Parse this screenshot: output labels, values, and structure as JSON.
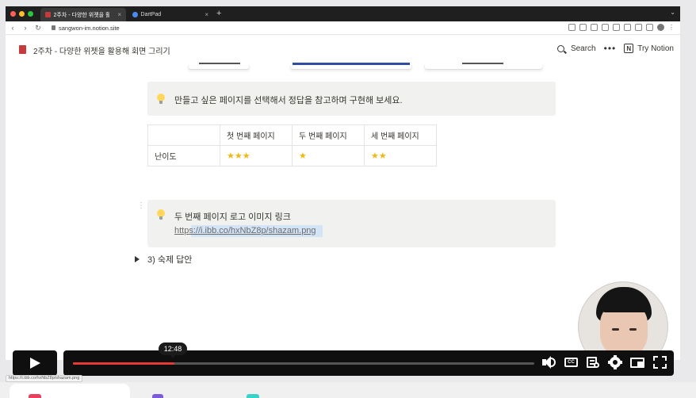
{
  "browser": {
    "tabs": [
      {
        "label": "2주차 - 다양한 위젯을 활용해 회",
        "favicon_color": "#c53a3a",
        "active": true
      },
      {
        "label": "DartPad",
        "favicon_color": "#4a8cf7",
        "active": false
      }
    ],
    "tab_close": "×",
    "new_tab": "+",
    "tab_menu": "⌄",
    "url": "sangwon-im.notion.site"
  },
  "notion": {
    "page_title": "2주차 - 다양한 위젯을 활용해 회면 그리기",
    "search_label": "Search",
    "more_label": "•••",
    "try_label": "Try Notion",
    "notion_logo": "N",
    "callout1_text": "만들고 싶은 페이지를 선택해서 정답을 참고하며 구현해 보세요.",
    "table": {
      "headers": [
        "",
        "첫 번째 페이지",
        "두 번째 페이지",
        "세 번째 페이지"
      ],
      "row_label": "난이도",
      "ratings": [
        "★★★",
        "★",
        "★★"
      ]
    },
    "callout2_title": "두 번째 페이지 로고 이미지 링크",
    "callout2_link": "https://i.ibb.co/hxNbZ8p/shazam.png",
    "toggle_label": "3) 숙제 답안",
    "drag_handle": "⋮⋮"
  },
  "player": {
    "scrub_time": "12:48",
    "progress_fraction": 0.22,
    "cc_label": "CC",
    "status_url": "https://i.ibb.co/hxNbZ8p/shazam.png"
  },
  "colors": {
    "progress": "#e53935",
    "star": "#f2b90f",
    "link_highlight": "#d4e4f7"
  }
}
